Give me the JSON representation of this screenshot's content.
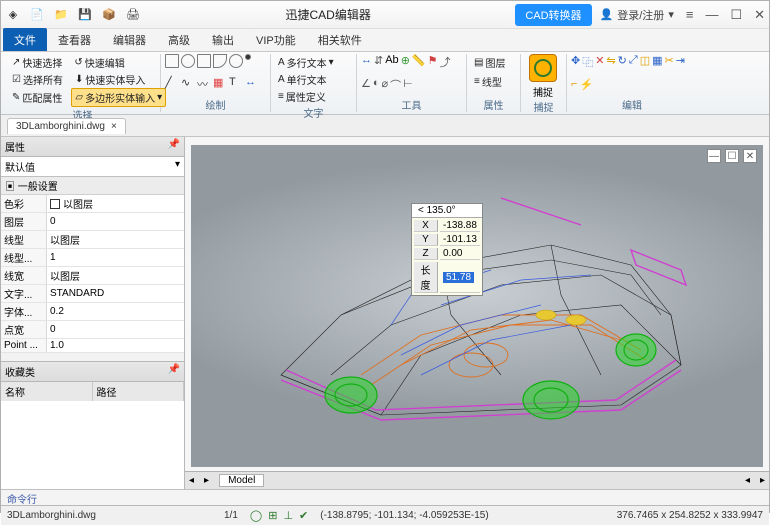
{
  "titlebar": {
    "title": "迅捷CAD编辑器",
    "convert_btn": "CAD转换器",
    "login": "登录/注册"
  },
  "tabs": [
    "文件",
    "查看器",
    "编辑器",
    "高级",
    "输出",
    "VIP功能",
    "相关软件"
  ],
  "ribbon": {
    "g_select": {
      "quick_select": "快速选择",
      "quick_edit": "快速编辑",
      "select_all": "选择所有",
      "fast_import": "快速实体导入",
      "match_prop": "匹配属性",
      "poly_input": "多边形实体输入",
      "label": "选择"
    },
    "g_draw": {
      "label": "绘制"
    },
    "g_text": {
      "multiline": "多行文本",
      "singleline": "单行文本",
      "propdef": "属性定义",
      "label": "文字"
    },
    "g_tools": {
      "label": "工具"
    },
    "g_layer": {
      "layer": "图层",
      "linetype": "线型",
      "label": "属性"
    },
    "g_capture": {
      "capture": "捕捉",
      "label": "捕捉"
    },
    "g_edit": {
      "label": "编辑"
    }
  },
  "file_tab": "3DLamborghini.dwg",
  "props": {
    "header": "属性",
    "dropdown": "默认值",
    "section": "一般设置",
    "rows": {
      "color_k": "色彩",
      "color_v": "以图层",
      "layer_k": "图层",
      "layer_v": "0",
      "ltype_k": "线型",
      "ltype_v": "以图层",
      "lscale_k": "线型...",
      "lscale_v": "1",
      "lweight_k": "线宽",
      "lweight_v": "以图层",
      "tstyle_k": "文字...",
      "tstyle_v": "STANDARD",
      "fsize_k": "字体...",
      "fsize_v": "0.2",
      "dot_k": "点宽",
      "dot_v": "0",
      "point_k": "Point ...",
      "point_v": "1.0"
    }
  },
  "fav": {
    "header": "收藏类",
    "col1": "名称",
    "col2": "路径"
  },
  "coords": {
    "angle_label": "< 135.0°",
    "x_k": "X",
    "x_v": "-138.88",
    "y_k": "Y",
    "y_v": "-101.13",
    "z_k": "Z",
    "z_v": "0.00",
    "len_k": "长度",
    "len_v": "51.78"
  },
  "modeltab": "Model",
  "cmdline": "命令行",
  "status": {
    "file": "3DLamborghini.dwg",
    "page": "1/1",
    "cursor": "(-138.8795; -101.134; -4.059253E-15)",
    "dims": "376.7465 x 254.8252 x 333.9947"
  }
}
